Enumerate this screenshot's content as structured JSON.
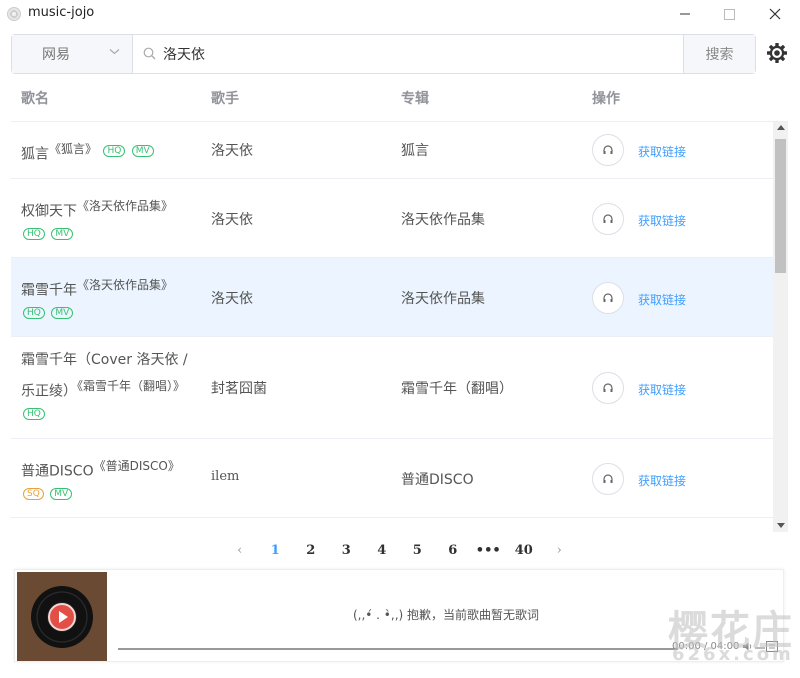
{
  "window": {
    "title": "music-jojo",
    "minimize_glyph": "—",
    "maximize_glyph": "☐",
    "close_glyph": "✕"
  },
  "search": {
    "source": "网易",
    "query": "洛天依",
    "button_label": "搜索"
  },
  "table": {
    "headers": {
      "name": "歌名",
      "singer": "歌手",
      "album": "专辑",
      "action": "操作"
    },
    "rows": [
      {
        "name_lines": [
          "狐言"
        ],
        "album_inline": "《狐言》",
        "badges": [
          "HQ",
          "MV"
        ],
        "singer": "洛天依",
        "album": "狐言",
        "action": "获取链接"
      },
      {
        "name_lines": [
          "权御天下"
        ],
        "album_inline": "《洛天依作品集》",
        "badges": [
          "HQ",
          "MV"
        ],
        "singer": "洛天依",
        "album": "洛天依作品集",
        "action": "获取链接"
      },
      {
        "name_lines": [
          "霜雪千年"
        ],
        "album_inline": "《洛天依作品集》",
        "badges": [
          "HQ",
          "MV"
        ],
        "singer": "洛天依",
        "album": "洛天依作品集",
        "action": "获取链接"
      },
      {
        "name_lines": [
          "霜雪千年（Cover 洛天依 / 乐正绫）"
        ],
        "album_inline": "《霜雪千年（翻唱）》",
        "badges": [
          "HQ"
        ],
        "singer": "封茗囧菌",
        "album": "霜雪千年（翻唱）",
        "action": "获取链接"
      },
      {
        "name_lines": [
          "普通DISCO"
        ],
        "album_inline": "《普通DISCO》",
        "badges": [
          "SQ",
          "MV"
        ],
        "singer": "ilem",
        "album": "普通DISCO",
        "action": "获取链接"
      }
    ],
    "highlighted_row": 2
  },
  "pagination": {
    "prev": "‹",
    "pages": [
      "1",
      "2",
      "3",
      "4",
      "5",
      "6",
      "•••",
      "40"
    ],
    "current": "1",
    "next": "›"
  },
  "player": {
    "lyric_text": "(,,•́ . •̀,,) 抱歉，当前歌曲暂无歌词",
    "time": "00:00 / 04:00",
    "progress": 0
  },
  "watermark": {
    "main": "樱花庄",
    "sub": "626x.com"
  },
  "colors": {
    "accent": "#409eff",
    "hq_badge": "#38c172",
    "sq_badge": "#e6a23c",
    "highlight_row": "#ecf5ff",
    "play_red": "#e24f47"
  }
}
